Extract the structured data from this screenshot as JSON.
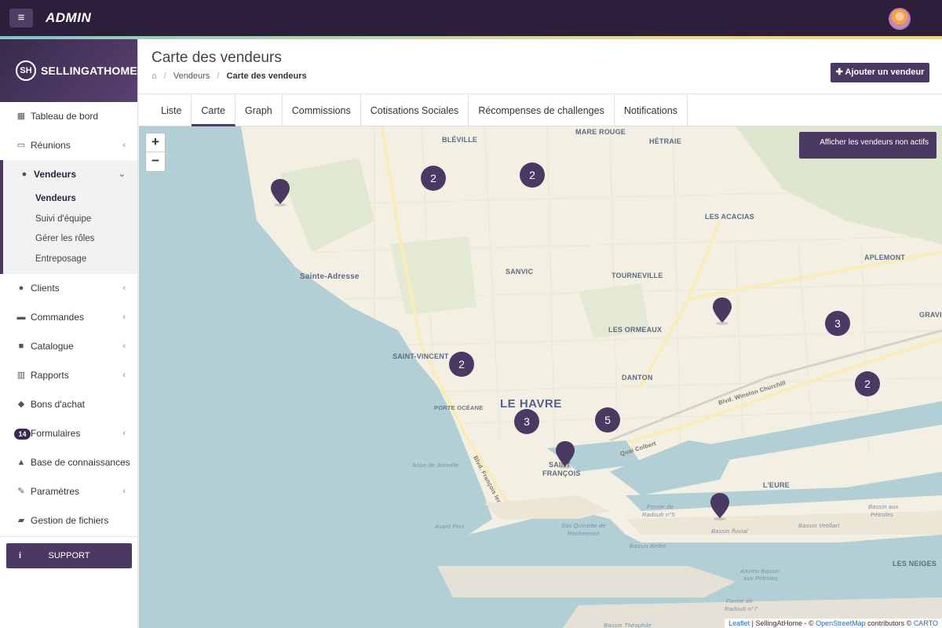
{
  "topbar": {
    "menu_icon": "≡",
    "title": "ADMIN",
    "avatar": "user-avatar"
  },
  "sidebar": {
    "logo_mark": "SH",
    "logo_text": "SELLINGATHOME",
    "items": [
      {
        "label": "Tableau de bord",
        "icon": "dashboard-icon"
      },
      {
        "label": "Réunions",
        "icon": "calendar-icon"
      },
      {
        "label": "Vendeurs",
        "icon": "users-icon"
      },
      {
        "label": "Clients",
        "icon": "users-icon"
      },
      {
        "label": "Commandes",
        "icon": "credit-card-icon"
      },
      {
        "label": "Catalogue",
        "icon": "archive-icon"
      },
      {
        "label": "Rapports",
        "icon": "bar-chart-icon"
      },
      {
        "label": "Bons d'achat",
        "icon": "tags-icon"
      },
      {
        "label": "Formulaires",
        "icon": "form-icon"
      },
      {
        "label": "Base de connaissances",
        "icon": "graduation-cap-icon"
      },
      {
        "label": "Paramètres",
        "icon": "wrench-icon"
      },
      {
        "label": "Gestion de fichiers",
        "icon": "folder-icon"
      }
    ],
    "sub_items": [
      "Vendeurs",
      "Suivi d'équipe",
      "Gérer les rôles",
      "Entreposage"
    ],
    "formulaires_badge": "14",
    "support_label": "SUPPORT",
    "support_icon": "i"
  },
  "header": {
    "title": "Carte des vendeurs",
    "breadcrumb": [
      "Vendeurs",
      "Carte des vendeurs"
    ],
    "add_button": "✚ Ajouter un vendeur"
  },
  "tabs": [
    "Liste",
    "Carte",
    "Graph",
    "Commissions",
    "Cotisations Sociales",
    "Récompenses de challenges",
    "Notifications"
  ],
  "map": {
    "zoom_in": "+",
    "zoom_out": "−",
    "inactive_button": "Afficher les vendeurs non actifs",
    "labels": {
      "bleville": "BLÉVILLE",
      "mare_rouge": "MARE ROUGE",
      "hetraie": "HÉTRAIE",
      "les_acacias": "LES ACACIAS",
      "aplemont": "APLEMONT",
      "sanvic": "SANVIC",
      "tourneville": "TOURNEVILLE",
      "sainte_adresse": "Sainte-Adresse",
      "les_ormeaux": "LES ORMEAUX",
      "gravill": "GRAVILL",
      "saint_vincent": "SAINT-VINCENT",
      "danton": "DANTON",
      "le_havre": "LE HAVRE",
      "porte_oceane": "PORTE OCÉANE",
      "saint": "SAINT",
      "francois": "FRANÇOIS",
      "bvd_churchill": "Blvd. Winston Churchill",
      "quai_colbert": "Quai Colbert",
      "bvd_francois": "Blvd. François Ier",
      "l_eure": "L'EURE",
      "anse_joinville": "Anse de Joinville",
      "avant_port": "Avant Port",
      "quinette_1": "Sas Quinette de",
      "quinette_2": "Rochemont",
      "radoub5_1": "Forme de",
      "radoub5_2": "Radoub n°5",
      "bassin_fluvial": "Bassin fluvial",
      "bassin_vetillart": "Bassin Vetillart",
      "bassin_petroles_1": "Bassin aux",
      "bassin_petroles_2": "Pétroles",
      "bassin_bellot": "Bassin Bellot",
      "ancien_bassin_1": "Ancien Bassin",
      "ancien_bassin_2": "aux Pétroles",
      "radoub7_1": "Forme de",
      "radoub7_2": "Radoub n°7",
      "les_neiges": "LES NEIGES",
      "bassin_theophile": "Bassin Théophile"
    },
    "clusters": [
      "2",
      "2",
      "3",
      "2",
      "2",
      "3",
      "5"
    ],
    "markers": 4,
    "attribution": {
      "leaflet": "Leaflet",
      "middle": " | SellingAtHome - © ",
      "osm": "OpenStreetMap",
      "contrib": " contributors © ",
      "carto": "CARTO"
    }
  }
}
